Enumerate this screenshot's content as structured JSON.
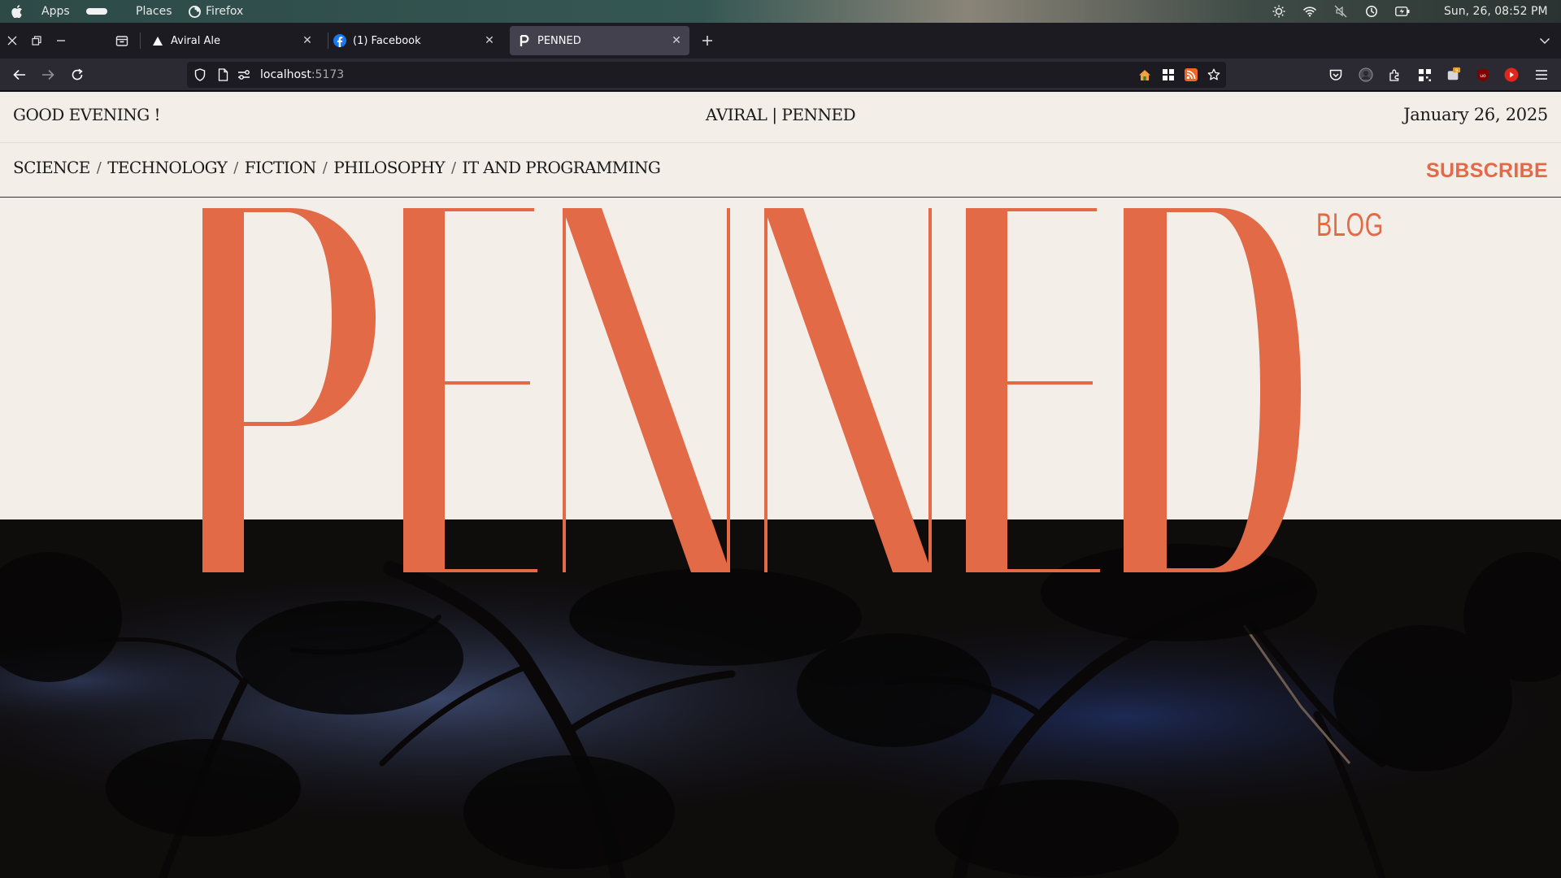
{
  "os_bar": {
    "menu_apps": "Apps",
    "menu_places": "Places",
    "menu_firefox": "Firefox",
    "clock": "Sun, 26, 08:52 PM"
  },
  "tabs": [
    {
      "title": "Aviral Ale",
      "icon": "vercel-icon",
      "active": false
    },
    {
      "title": "(1) Facebook",
      "icon": "facebook-icon",
      "active": false
    },
    {
      "title": "PENNED",
      "icon": "penned-favicon",
      "active": true
    }
  ],
  "urlbar": {
    "host": "localhost",
    "port": ":5173"
  },
  "page": {
    "greeting": "GOOD EVENING !",
    "site_name": "AVIRAL | PENNED",
    "date": "January 26, 2025",
    "categories": [
      "SCIENCE",
      "TECHNOLOGY",
      "FICTION",
      "PHILOSOPHY",
      "IT AND PROGRAMMING"
    ],
    "category_separator": "/",
    "subscribe": "SUBSCRIBE",
    "hero_title": "PENNED",
    "hero_tag": "BLOG"
  },
  "colors": {
    "accent": "#e4694a",
    "page_bg": "#f3efe8",
    "hero_bg": "#0f0c0c",
    "browser_chrome": "#2b2a33"
  }
}
